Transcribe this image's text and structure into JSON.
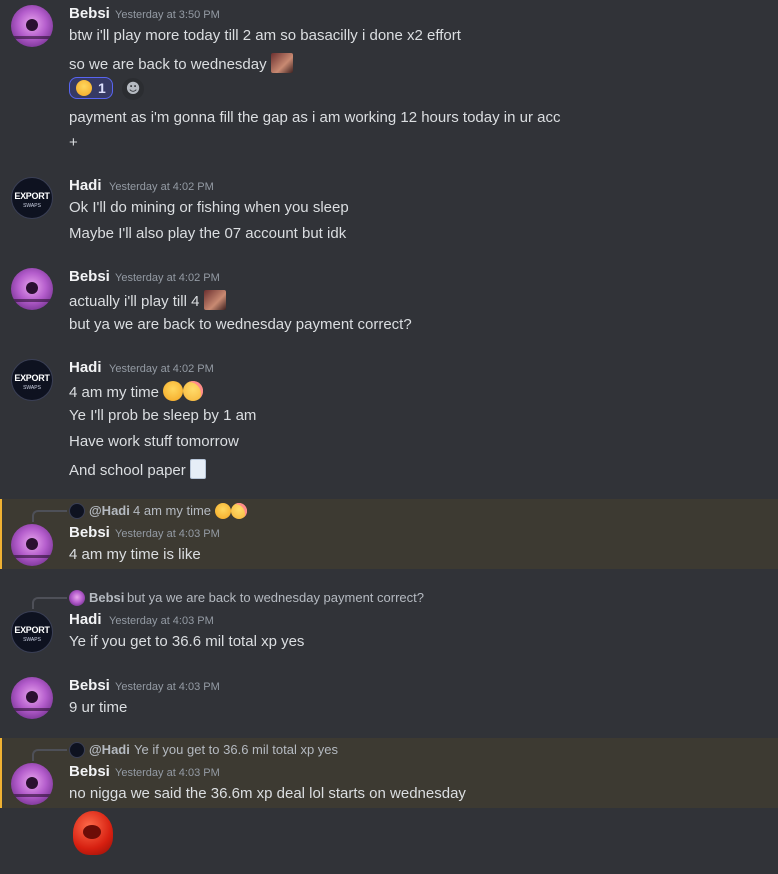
{
  "messages": [
    {
      "author": "Bebsi",
      "timestamp": "Yesterday at 3:50 PM",
      "lines": [
        "btw i'll play more today till 2 am so basacilly i done x2 effort",
        "so we are back to wednesday",
        "payment as i'm gonna fill the gap as i am working 12 hours today in ur acc",
        "+"
      ],
      "reaction": {
        "emoji": "rolling-on-floor-laughing-emoji",
        "count": "1"
      }
    },
    {
      "author": "Hadi",
      "timestamp": "Yesterday at 4:02 PM",
      "lines": [
        "Ok I'll do mining or fishing when you sleep",
        "Maybe I'll also play the 07 account but idk"
      ]
    },
    {
      "author": "Bebsi",
      "timestamp": "Yesterday at 4:02 PM",
      "lines": [
        "actually i'll play till 4",
        "but ya we are back to wednesday payment correct?"
      ]
    },
    {
      "author": "Hadi",
      "timestamp": "Yesterday at 4:02 PM",
      "lines": [
        "4 am my time",
        "Ye I'll prob be sleep by 1 am",
        "Have work stuff tomorrow",
        "And school paper"
      ]
    },
    {
      "author": "Bebsi",
      "timestamp": "Yesterday at 4:03 PM",
      "reply": {
        "name": "@Hadi",
        "text": "4 am my time"
      },
      "lines": [
        "4 am my time is like"
      ]
    },
    {
      "author": "Hadi",
      "timestamp": "Yesterday at 4:03 PM",
      "reply": {
        "name": "Bebsi",
        "text": "but ya we are back to wednesday payment correct?"
      },
      "lines": [
        "Ye if you get to 36.6 mil total xp yes"
      ]
    },
    {
      "author": "Bebsi",
      "timestamp": "Yesterday at 4:03 PM",
      "lines": [
        "9 ur time"
      ]
    },
    {
      "author": "Bebsi",
      "timestamp": "Yesterday at 4:03 PM",
      "reply": {
        "name": "@Hadi",
        "text": "Ye if you get to 36.6 mil total xp yes"
      },
      "lines": [
        "no nigga we said the 36.6m xp deal lol starts on wednesday"
      ]
    }
  ],
  "avatars": {
    "hadi_text_main": "EXPORT",
    "hadi_text_sub": "SWAPS"
  },
  "add_reaction_icon": "smiley-add-reaction-icon",
  "colors": {
    "background": "#313338",
    "highlight": "#3d3a32",
    "mention_accent": "#f0b232",
    "reaction_bg": "#373a64",
    "reaction_border": "#5865f2"
  }
}
